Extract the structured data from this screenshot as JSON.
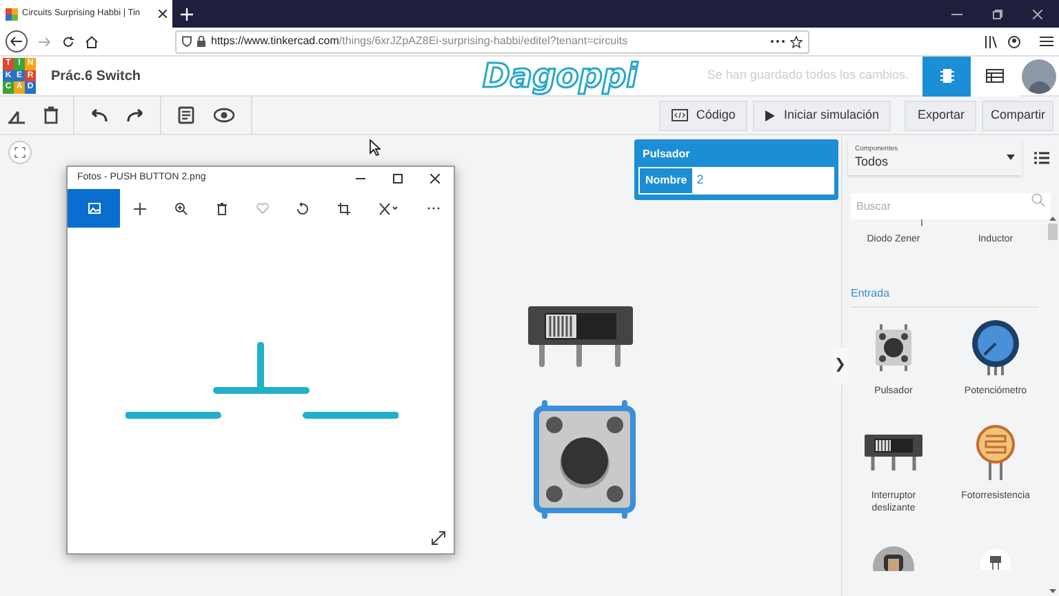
{
  "browser": {
    "tab_title": "Circuits Surprising Habbi | Tin",
    "url_host": "https://www.tinkercad.com",
    "url_path": "/things/6xrJZpAZ8Ei-surprising-habbi/editel?tenant=circuits"
  },
  "app": {
    "logo_letters": [
      "T",
      "I",
      "N",
      "K",
      "E",
      "R",
      "C",
      "A",
      "D"
    ],
    "title": "Prác.6 Switch",
    "brand": "Dagoppi",
    "save_status": "Se han guardado todos los cambios.",
    "views": [
      {
        "kind": "components",
        "selected": true
      },
      {
        "kind": "table",
        "selected": false
      }
    ]
  },
  "toolbar": {
    "code_button": "Código",
    "simulate_button": "Iniciar simulación",
    "export_button": "Exportar",
    "share_button": "Compartir"
  },
  "inspector": {
    "title": "Pulsador",
    "field_label": "Nombre",
    "field_value": "2"
  },
  "photos_window": {
    "title": "Fotos - PUSH BUTTON 2.png"
  },
  "panel": {
    "filter_label": "Componentes",
    "filter_value": "Todos",
    "search_placeholder": "Buscar",
    "collapse": "❯",
    "top_items": [
      {
        "name": "Diodo Zener"
      },
      {
        "name": "Inductor"
      }
    ],
    "section": "Entrada",
    "items": [
      {
        "kind": "pushbutton",
        "name": "Pulsador"
      },
      {
        "kind": "potentiometer",
        "name": "Potenciómetro"
      },
      {
        "kind": "slideswitch",
        "name": "Interruptor deslizante"
      },
      {
        "kind": "photoresistor",
        "name": "Fotorresistencia"
      },
      {
        "kind": "sensor"
      },
      {
        "kind": "lightsensor"
      }
    ]
  }
}
